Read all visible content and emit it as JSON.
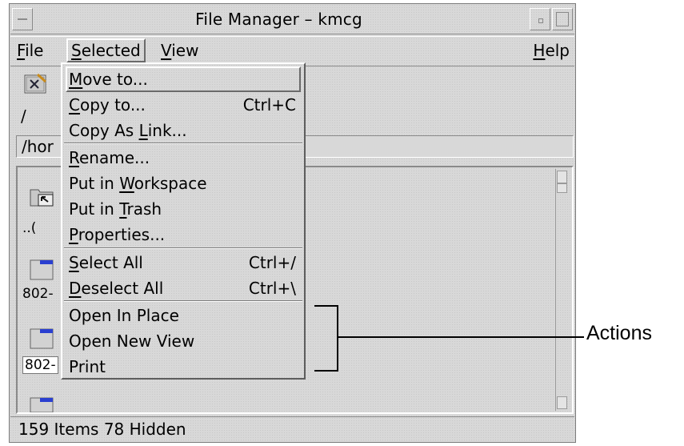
{
  "window": {
    "title": "File Manager – kmcg"
  },
  "menubar": {
    "file": "File",
    "selected": "Selected",
    "view": "View",
    "help": "Help"
  },
  "toolbar": {
    "path_label": "/",
    "path_field_text": "/hor"
  },
  "selected_menu": {
    "items": [
      {
        "label": "Move to...",
        "accel": "",
        "icon": ""
      },
      {
        "label": "Copy to...",
        "accel": "Ctrl+C"
      },
      {
        "label": "Copy As Link...",
        "accel": ""
      },
      {
        "label": "Rename...",
        "accel": ""
      },
      {
        "label": "Put in Workspace",
        "accel": ""
      },
      {
        "label": "Put in Trash",
        "accel": ""
      },
      {
        "label": "Properties...",
        "accel": ""
      },
      {
        "label": "Select All",
        "accel": "Ctrl+/"
      },
      {
        "label": "Deselect All",
        "accel": "Ctrl+\\"
      },
      {
        "label": "Open In Place",
        "accel": ""
      },
      {
        "label": "Open New View",
        "accel": ""
      },
      {
        "label": "Print",
        "accel": ""
      }
    ]
  },
  "files": [
    {
      "name": "..(",
      "icon": "folder-up-icon"
    },
    {
      "name": "802-",
      "icon": "folder-icon"
    },
    {
      "name": "802-",
      "icon": "folder-icon"
    },
    {
      "name": "",
      "icon": "folder-icon"
    }
  ],
  "statusbar": {
    "text": "159 Items 78 Hidden"
  },
  "annotation": {
    "label": "Actions"
  },
  "colors": {
    "window_bg": "#d8d8d8",
    "folder_blue": "#2a3fd0"
  }
}
